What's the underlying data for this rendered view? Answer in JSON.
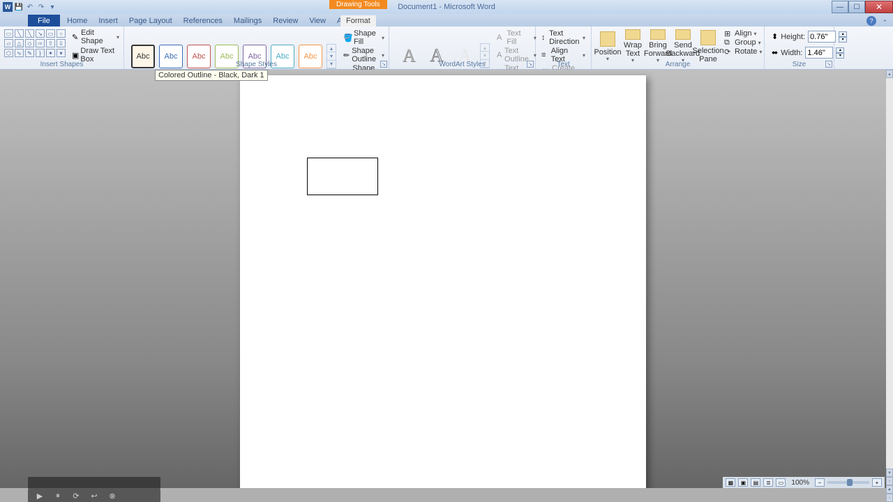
{
  "titlebar": {
    "drawing_tools": "Drawing Tools",
    "doc_title": "Document1 - Microsoft Word"
  },
  "tabs": {
    "file": "File",
    "home": "Home",
    "insert": "Insert",
    "page_layout": "Page Layout",
    "references": "References",
    "mailings": "Mailings",
    "review": "Review",
    "view": "View",
    "addins": "Add-Ins",
    "format": "Format"
  },
  "groups": {
    "insert_shapes": "Insert Shapes",
    "shape_styles": "Shape Styles",
    "wordart_styles": "WordArt Styles",
    "text": "Text",
    "arrange": "Arrange",
    "size": "Size"
  },
  "insert_shapes": {
    "edit_shape": "Edit Shape",
    "draw_text_box": "Draw Text Box"
  },
  "shape_styles": {
    "abc": "Abc",
    "shape_fill": "Shape Fill",
    "shape_outline": "Shape Outline",
    "shape_effects": "Shape Effects"
  },
  "wordart": {
    "letter": "A",
    "text_fill": "Text Fill",
    "text_outline": "Text Outline",
    "text_effects": "Text Effects"
  },
  "text": {
    "text_direction": "Text Direction",
    "align_text": "Align Text",
    "create_link": "Create Link"
  },
  "arrange": {
    "position": "Position",
    "wrap_text": "Wrap Text",
    "bring_forward": "Bring Forward",
    "send_backward": "Send Backward",
    "selection_pane": "Selection Pane",
    "align": "Align",
    "group": "Group",
    "rotate": "Rotate"
  },
  "size": {
    "height_label": "Height:",
    "height_value": "0.76\"",
    "width_label": "Width:",
    "width_value": "1.46\""
  },
  "tooltip": "Colored Outline - Black, Dark 1",
  "zoom": {
    "value": "100%"
  }
}
